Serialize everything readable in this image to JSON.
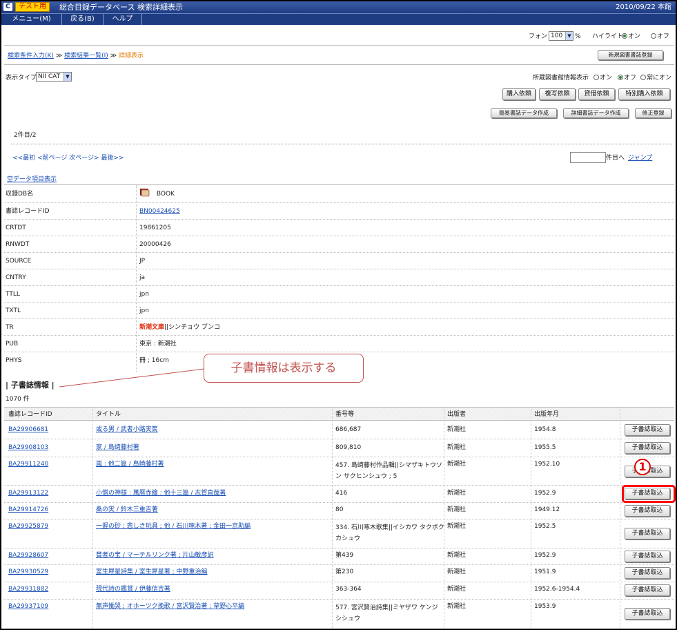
{
  "titlebar": {
    "logo": "C",
    "test_badge": "テスト用",
    "title": "総合目録データベース 検索詳細表示",
    "date_library": "2010/09/22 本館"
  },
  "menu": [
    {
      "label": "メニュー(M)"
    },
    {
      "label": "戻る(B)"
    },
    {
      "label": "ヘルプ"
    }
  ],
  "font_controls": {
    "font_label": "フォント",
    "font_size": "100",
    "percent": "%",
    "highlight_label": "ハイライト",
    "on": "オン",
    "off": "オフ"
  },
  "breadcrumb": {
    "step1": "検索条件入力(K)",
    "step2": "検索結果一覧(I)",
    "current": "詳細表示",
    "separator": "≫"
  },
  "new_registration_button": "新規図書書誌登録",
  "display_type": {
    "label": "表示タイプ",
    "value": "NII CAT"
  },
  "holding_info": {
    "label": "所蔵図書館情報表示",
    "on": "オン",
    "off": "オフ",
    "always": "常にオン"
  },
  "action_buttons_row1": [
    "購入依頼",
    "複写依頼",
    "貸借依頼",
    "特別購入依頼"
  ],
  "action_buttons_row2": [
    "簡易書誌データ作成",
    "詳細書誌データ作成",
    "修正登録"
  ],
  "record_count": "2件目/2",
  "pager": {
    "first": "<<最初",
    "prev": "<前ページ",
    "next": "次ページ>",
    "last": "最後>>",
    "jump_suffix": "件目へ",
    "jump": "ジャンプ"
  },
  "empty_fields_link": "空データ項目表示",
  "detail_rows": [
    {
      "key": "収録DB名",
      "value": "BOOK"
    },
    {
      "key": "書誌レコードID",
      "value": "BN00424625"
    },
    {
      "key": "CRTDT",
      "value": "19861205"
    },
    {
      "key": "RNWDT",
      "value": "20000426"
    },
    {
      "key": "SOURCE",
      "value": "JP"
    },
    {
      "key": "CNTRY",
      "value": "ja"
    },
    {
      "key": "TTLL",
      "value": "jpn"
    },
    {
      "key": "TXTL",
      "value": "jpn"
    },
    {
      "key": "TR",
      "value_red": "新潮文庫",
      "value": "||シンチョウ ブンコ"
    },
    {
      "key": "PUB",
      "value": "東京 : 新潮社"
    },
    {
      "key": "PHYS",
      "value": "冊 ; 16cm"
    }
  ],
  "callout_text": "子書情報は表示する",
  "child_section": {
    "title": "| 子書誌情報 |",
    "count": "1070 件"
  },
  "child_headers": [
    "書誌レコードID",
    "タイトル",
    "番号等",
    "出版者",
    "出版年月"
  ],
  "child_rows": [
    {
      "id": "BA29906681",
      "title": "或る男 / 武者小路実篤",
      "number": "686,687",
      "publisher": "新潮社",
      "year": "1954.8",
      "button": "子書誌取込"
    },
    {
      "id": "BA29908103",
      "title": "家 / 島崎藤村著",
      "number": "809,810",
      "publisher": "新潮社",
      "year": "1955.5",
      "button": "子書誌取込"
    },
    {
      "id": "BA29911240",
      "title": "嵐 : 他二篇 / 島崎藤村著",
      "number": "457. 島崎藤村作品輯||シマザキトウソン サクヒンシュウ ; 5",
      "publisher": "新潮社",
      "year": "1952.10",
      "button": "子書誌取込"
    },
    {
      "id": "BA29913122",
      "title": "小僧の神様 : 萬暦赤繪 : 他十三篇 / 志賀直哉著",
      "number": "416",
      "publisher": "新潮社",
      "year": "1952.9",
      "button": "子書誌取込"
    },
    {
      "id": "BA29914726",
      "title": "桑の実 / 鈴木三重吉著",
      "number": "80",
      "publisher": "新潮社",
      "year": "1949.12",
      "button": "子書誌取込"
    },
    {
      "id": "BA29925879",
      "title": "一握の砂 ; 悲しき玩具 ; 他 / 石川啄木著 ; 金田一京助編",
      "number": "334. 石川啄木歌集||イシカワ タクボクカシュウ",
      "publisher": "新潮社",
      "year": "1952.5",
      "button": "子書誌取込"
    },
    {
      "id": "BA29928607",
      "title": "貧者の宝 / マーテルリンク著 ; 片山敏彦訳",
      "number": "第439",
      "publisher": "新潮社",
      "year": "1952.9",
      "button": "子書誌取込"
    },
    {
      "id": "BA29930529",
      "title": "室生犀星詩集 / 室生犀星著 ; 中野重治編",
      "number": "第230",
      "publisher": "新潮社",
      "year": "1951.9",
      "button": "子書誌取込"
    },
    {
      "id": "BA29931882",
      "title": "現代詩の鑑賞 / 伊藤信吉著",
      "number": "363-364",
      "publisher": "新潮社",
      "year": "1952.6-1954.4",
      "button": "子書誌取込"
    },
    {
      "id": "BA29937109",
      "title": "無声慟哭 ; オホーツク挽歌 / 宮沢賢治著 ; 草野心平編",
      "number": "577. 宮沢賢治詩集||ミヤザワ ケンジ シシュウ",
      "publisher": "新潮社",
      "year": "1953.9",
      "button": "子書誌取込"
    }
  ],
  "annotation_number": "1",
  "colors": {
    "title_bar": "#1e3c82",
    "link": "#1a4fb4",
    "callout": "#c0504d",
    "highlight_box": "#ff0000"
  }
}
